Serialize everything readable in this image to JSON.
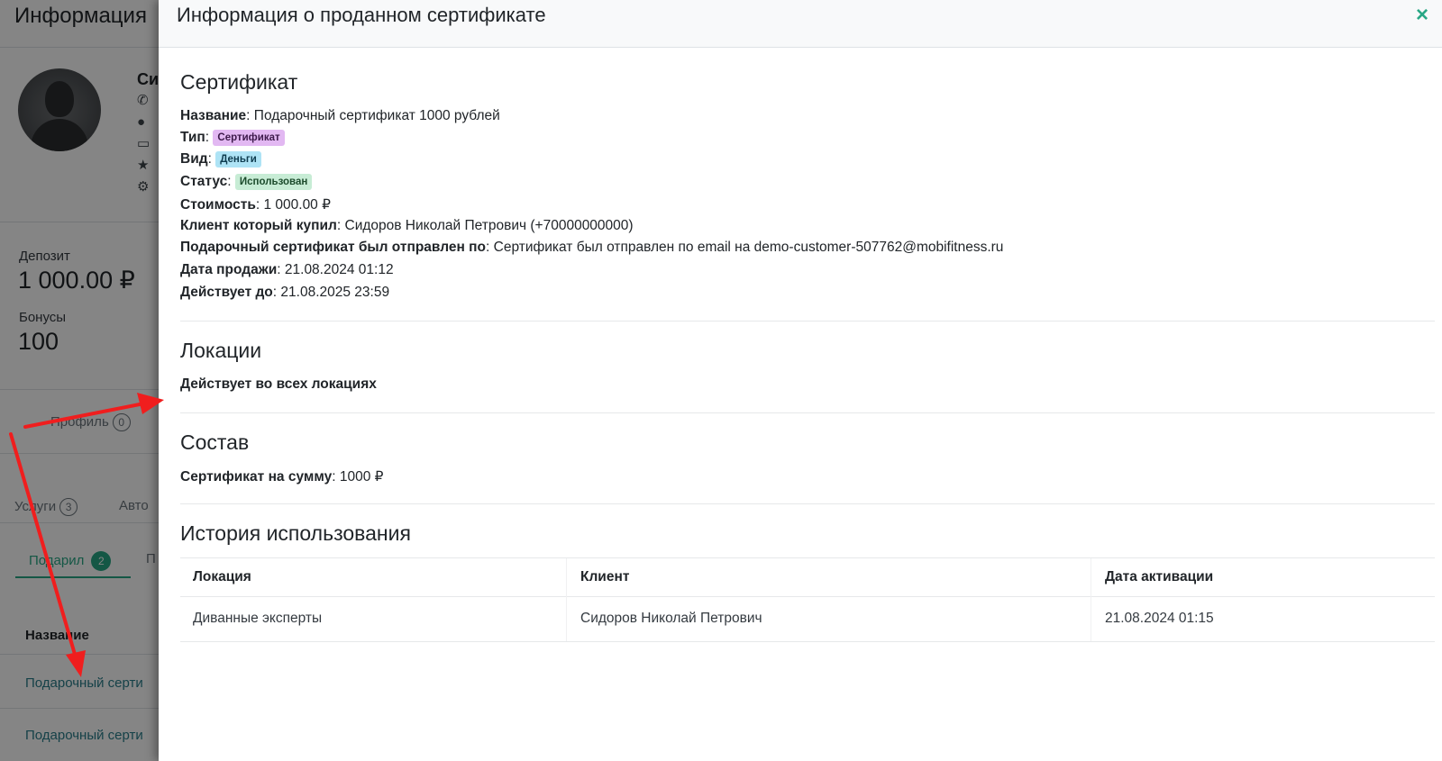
{
  "background": {
    "title": "Информация",
    "name_fragment": "Си",
    "deposit_label": "Депозит",
    "deposit_value": "1 000.00 ₽",
    "bonus_label": "Бонусы",
    "bonus_value": "100",
    "tab_profile": "Профиль",
    "tab_profile_count": "0",
    "tab_services": "Услуги",
    "tab_services_count": "3",
    "tab_auto": "Авто",
    "subtab_gifted": "Подарил",
    "subtab_gifted_count": "2",
    "subtab_other": "П",
    "table_header": "Название",
    "row1": "Подарочный серти",
    "row2": "Подарочный серти"
  },
  "modal": {
    "title": "Информация о проданном сертификате",
    "close_label": "×",
    "certificate_section": {
      "title": "Сертификат",
      "name_label": "Название",
      "name_value": "Подарочный сертификат 1000 рублей",
      "type_label": "Тип",
      "type_badge": "Сертификат",
      "kind_label": "Вид",
      "kind_badge": "Деньги",
      "status_label": "Статус",
      "status_badge": "Использован",
      "price_label": "Стоимость",
      "price_value": "1 000.00 ₽",
      "buyer_label": "Клиент который купил",
      "buyer_value": "Сидоров Николай Петрович (+70000000000)",
      "sent_label": "Подарочный сертификат был отправлен по",
      "sent_value": "Сертификат был отправлен по email на demo-customer-507762@mobifitness.ru",
      "sale_date_label": "Дата продажи",
      "sale_date_value": "21.08.2024 01:12",
      "valid_label": "Действует до",
      "valid_value": "21.08.2025 23:59"
    },
    "locations_section": {
      "title": "Локации",
      "text": "Действует во всех локациях"
    },
    "composition_section": {
      "title": "Состав",
      "label": "Сертификат на сумму",
      "value": "1000 ₽"
    },
    "history_section": {
      "title": "История использования",
      "columns": [
        "Локация",
        "Клиент",
        "Дата активации"
      ],
      "rows": [
        [
          "Диванные эксперты",
          "Сидоров Николай Петрович",
          "21.08.2024 01:15"
        ]
      ]
    }
  },
  "colors": {
    "accent": "#28a785",
    "annotation_arrow": "#f01e1e"
  }
}
